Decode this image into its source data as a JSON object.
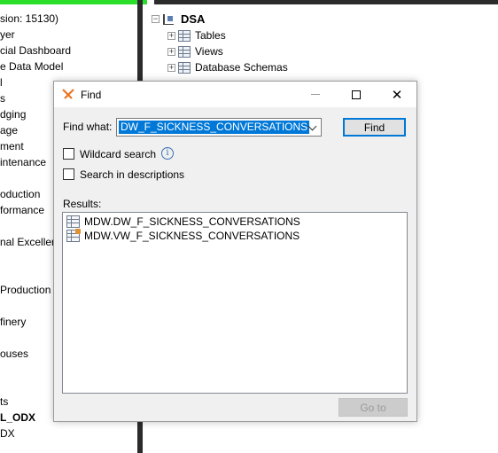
{
  "background": {
    "left_panel_items": [
      {
        "text": "sion: 15130)",
        "bold": false
      },
      {
        "text": "yer",
        "bold": false
      },
      {
        "text": "cial Dashboard",
        "bold": false
      },
      {
        "text": "e Data Model",
        "bold": false
      },
      {
        "text": "l",
        "bold": false
      },
      {
        "text": "s",
        "bold": false
      },
      {
        "text": "dging",
        "bold": false
      },
      {
        "text": "age",
        "bold": false
      },
      {
        "text": "ment",
        "bold": false
      },
      {
        "text": "intenance",
        "bold": false
      },
      {
        "text": "",
        "bold": false
      },
      {
        "text": "oduction",
        "bold": false
      },
      {
        "text": "formance",
        "bold": false
      },
      {
        "text": "",
        "bold": false
      },
      {
        "text": "nal Excellence",
        "bold": false
      },
      {
        "text": "",
        "bold": false
      },
      {
        "text": "",
        "bold": false
      },
      {
        "text": "Production",
        "bold": false
      },
      {
        "text": "",
        "bold": false
      },
      {
        "text": "finery",
        "bold": false
      },
      {
        "text": "",
        "bold": false
      },
      {
        "text": "ouses",
        "bold": false
      },
      {
        "text": "",
        "bold": false
      },
      {
        "text": "",
        "bold": false
      },
      {
        "text": "ts",
        "bold": false
      },
      {
        "text": "L_ODX",
        "bold": true
      },
      {
        "text": "DX",
        "bold": false
      }
    ],
    "tree": {
      "root_label": "DSA",
      "children": [
        "Tables",
        "Views",
        "Database Schemas"
      ],
      "expander_minus": "−",
      "expander_plus": "+"
    }
  },
  "dialog": {
    "title": "Find",
    "close_glyph": "✕",
    "find_what_label": "Find what:",
    "find_what_value": "DW_F_SICKNESS_CONVERSATIONS",
    "find_button": "Find",
    "wildcard_label": "Wildcard search",
    "wildcard_checked": false,
    "info_glyph": "i",
    "search_descriptions_label": "Search in descriptions",
    "search_descriptions_checked": false,
    "results_label": "Results:",
    "results": [
      {
        "text": "MDW.DW_F_SICKNESS_CONVERSATIONS",
        "icon": "table-icon"
      },
      {
        "text": "MDW.VW_F_SICKNESS_CONVERSATIONS",
        "icon": "view-icon"
      }
    ],
    "goto_button": "Go to",
    "goto_enabled": false
  },
  "colors": {
    "accent": "#0078d7",
    "topbar_green": "#2adf2a",
    "app_logo_orange": "#e87722"
  }
}
